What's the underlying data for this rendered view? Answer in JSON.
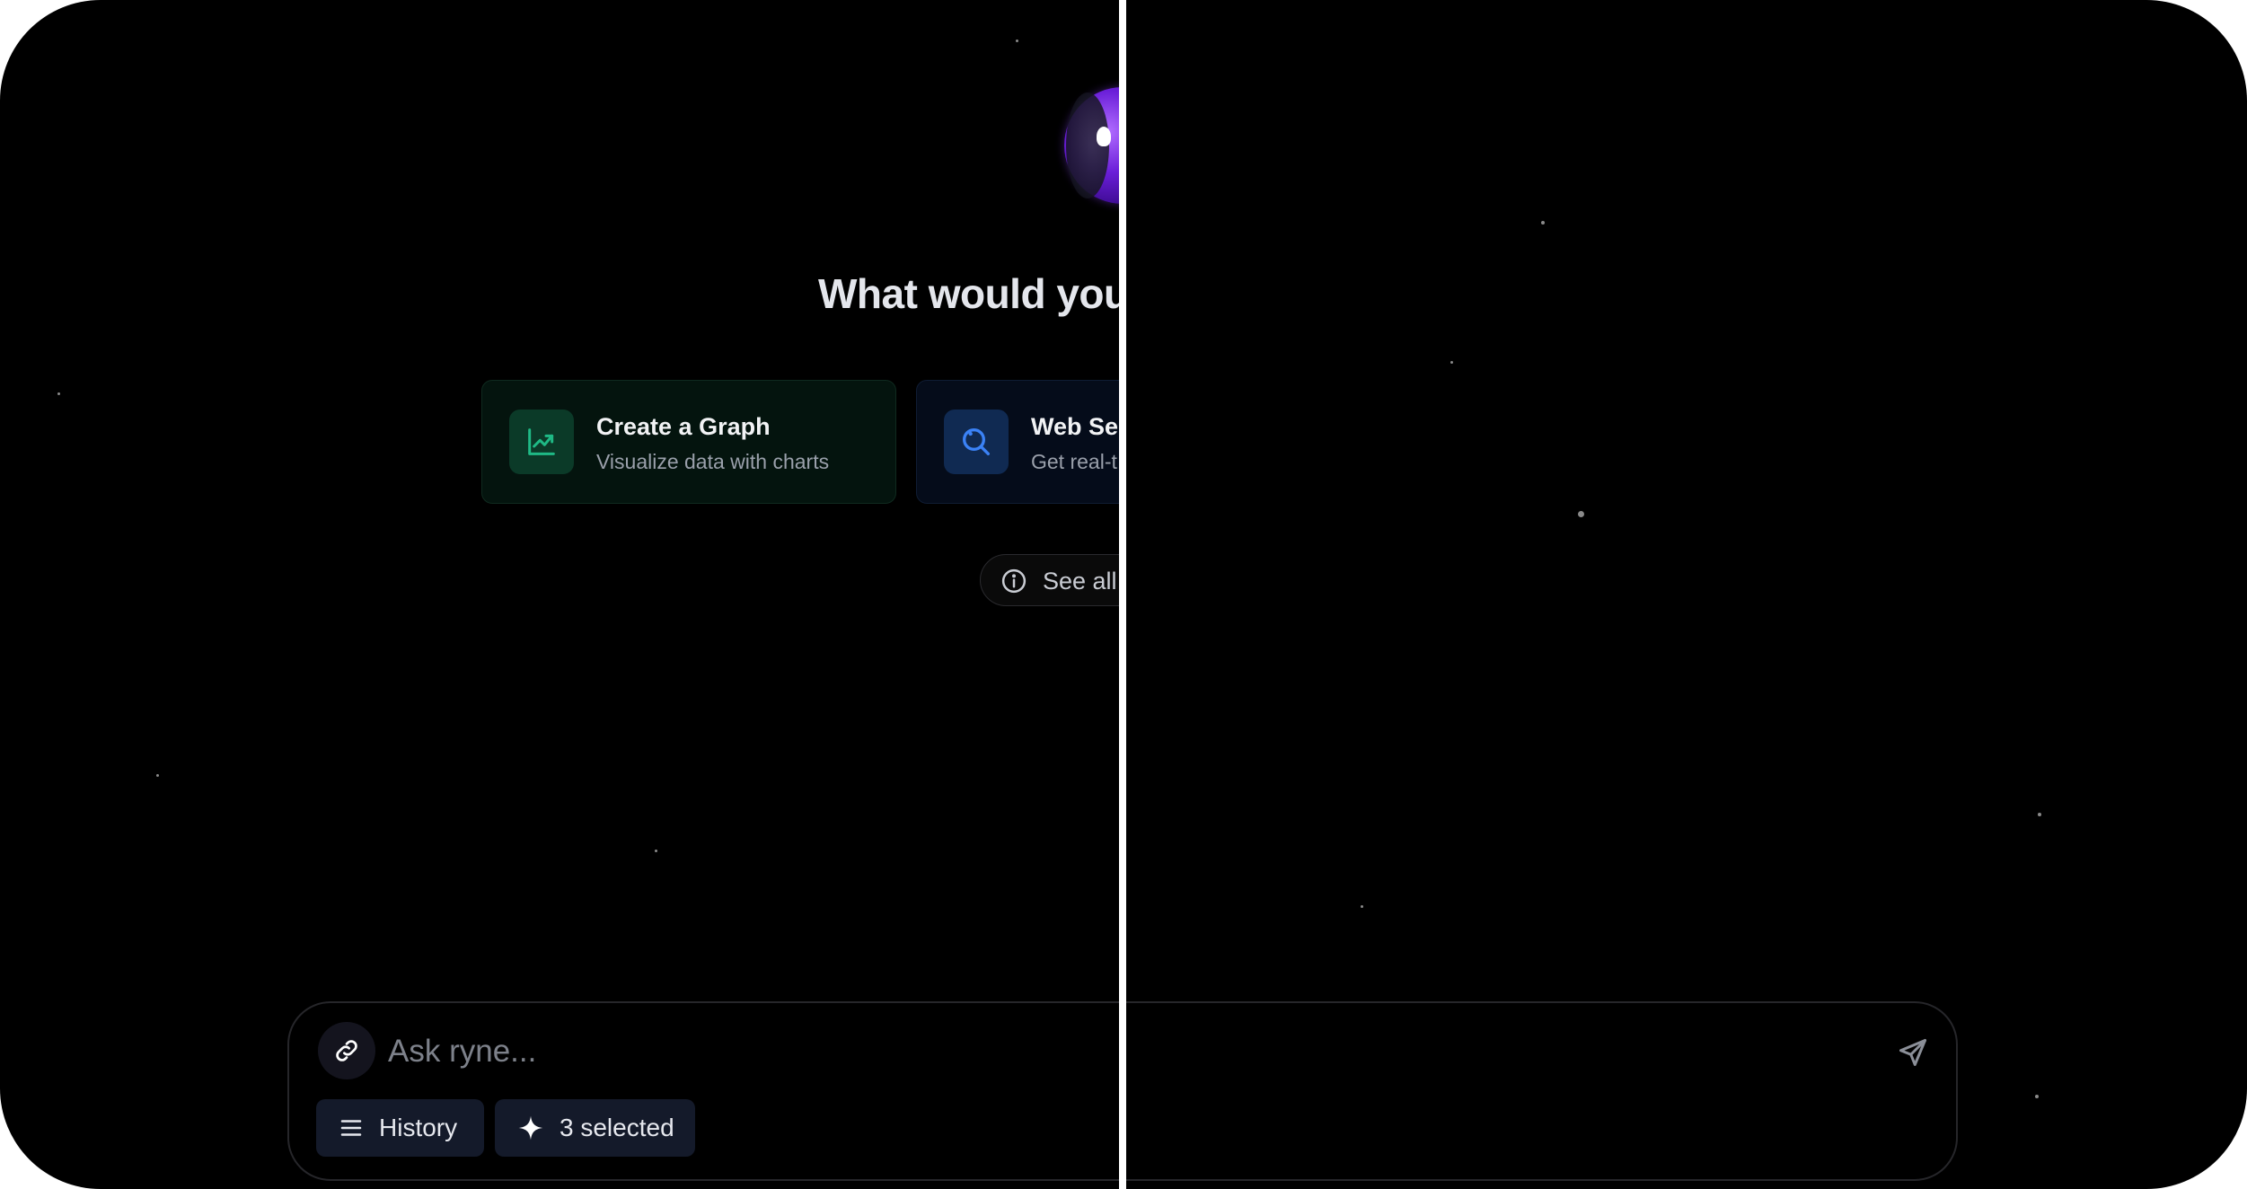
{
  "hero": {
    "headline": "What would you"
  },
  "actions": [
    {
      "title": "Create a Graph",
      "subtitle": "Visualize data with charts",
      "icon": "chart-line-icon",
      "accent": "#1fb985"
    },
    {
      "title": "Web Se",
      "subtitle": "Get real-t",
      "icon": "search-icon",
      "accent": "#3b82f6"
    }
  ],
  "see_all": {
    "label": "See all",
    "icon": "info-icon"
  },
  "composer": {
    "placeholder": "Ask ryne...",
    "attach_icon": "link-icon",
    "send_icon": "send-icon",
    "history_label": "History",
    "history_icon": "menu-icon",
    "selected_label": "3 selected",
    "selected_icon": "sparkle-icon"
  },
  "colors": {
    "background": "#000000",
    "divider": "#ffffff",
    "graph_accent": "#1fb985",
    "search_accent": "#3b82f6",
    "orb": "#6a1ed8"
  }
}
